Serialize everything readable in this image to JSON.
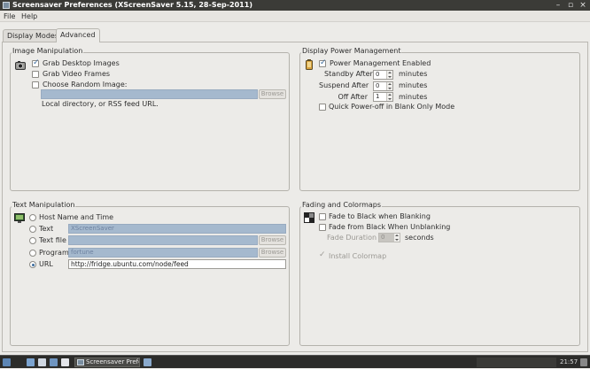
{
  "window": {
    "title": "Screensaver Preferences  (XScreenSaver 5.15, 28-Sep-2011)"
  },
  "menu": {
    "file": "File",
    "help": "Help"
  },
  "tabs": {
    "display_modes": "Display Modes",
    "advanced": "Advanced"
  },
  "image_manipulation": {
    "label": "Image Manipulation",
    "grab_desktop": "Grab Desktop Images",
    "grab_video": "Grab Video Frames",
    "choose_random": "Choose Random Image:",
    "random_path_value": "",
    "browse": "Browse",
    "hint": "Local directory, or RSS feed URL."
  },
  "power": {
    "label": "Display Power Management",
    "enabled": "Power Management Enabled",
    "standby": "Standby After",
    "standby_value": "0",
    "suspend": "Suspend After",
    "suspend_value": "0",
    "off": "Off After",
    "off_value": "1",
    "unit": "minutes",
    "quick_off": "Quick Power-off in Blank Only Mode"
  },
  "text_manipulation": {
    "label": "Text Manipulation",
    "host": "Host Name and Time",
    "text": "Text",
    "text_value": "XScreenSaver",
    "textfile": "Text file",
    "textfile_value": "",
    "program": "Program",
    "program_value": "fortune",
    "url": "URL",
    "url_value": "http://fridge.ubuntu.com/node/feed",
    "browse": "Browse"
  },
  "fading": {
    "label": "Fading and Colormaps",
    "fade_to_black": "Fade to Black when Blanking",
    "fade_from_black": "Fade from Black When Unblanking",
    "fade_duration": "Fade Duration",
    "fade_duration_value": "0",
    "seconds": "seconds",
    "install_colormap": "Install Colormap"
  },
  "taskbar": {
    "task_label": "Screensaver Prefere...",
    "clock": "21:57"
  },
  "colors": {
    "selection_blue": "#a5b9ce",
    "titlebar": "#3b3b37",
    "accent": "#3d6d9e"
  }
}
